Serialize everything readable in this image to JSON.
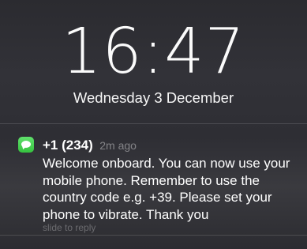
{
  "lock_screen": {
    "time": "16:47",
    "date": "Wednesday 3 December"
  },
  "notification": {
    "app_icon": "messages-icon",
    "sender": "+1 (234)",
    "time_ago": "2m ago",
    "message": "Welcome onboard. You can now use your\nmobile phone. Remember to use the\ncountry code e.g. +39.  Please set your\nphone to vibrate. Thank you",
    "action_hint": "slide to reply"
  },
  "colors": {
    "background": "#2e2e34",
    "messages_green": "#36c33f"
  }
}
